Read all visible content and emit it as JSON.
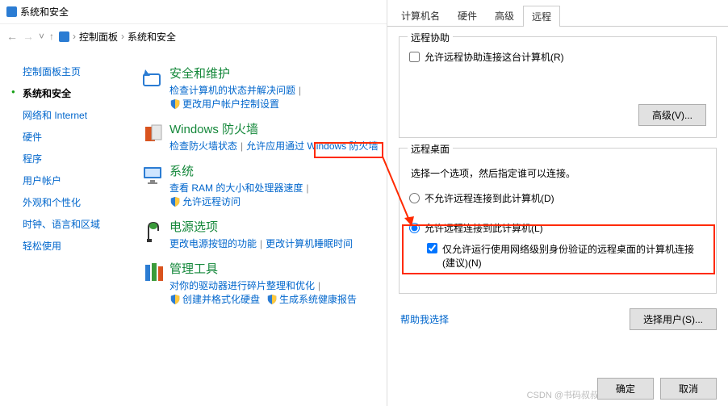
{
  "header": {
    "title": "系统和安全"
  },
  "breadcrumb": {
    "root": "控制面板",
    "current": "系统和安全"
  },
  "sidebar": {
    "items": [
      {
        "label": "控制面板主页"
      },
      {
        "label": "系统和安全",
        "active": true
      },
      {
        "label": "网络和 Internet"
      },
      {
        "label": "硬件"
      },
      {
        "label": "程序"
      },
      {
        "label": "用户帐户"
      },
      {
        "label": "外观和个性化"
      },
      {
        "label": "时钟、语言和区域"
      },
      {
        "label": "轻松使用"
      }
    ]
  },
  "categories": [
    {
      "title": "安全和维护",
      "links": [
        {
          "text": "检查计算机的状态并解决问题",
          "shield": false
        },
        {
          "text": "更改用户帐户控制设置",
          "shield": true
        }
      ]
    },
    {
      "title": "Windows 防火墙",
      "links": [
        {
          "text": "检查防火墙状态",
          "shield": false
        },
        {
          "text": "允许应用通过 Windows 防火墙",
          "shield": false
        }
      ]
    },
    {
      "title": "系统",
      "links": [
        {
          "text": "查看 RAM 的大小和处理器速度",
          "shield": false
        },
        {
          "text": "允许远程访问",
          "shield": true,
          "highlight": true
        }
      ]
    },
    {
      "title": "电源选项",
      "links": [
        {
          "text": "更改电源按钮的功能",
          "shield": false
        },
        {
          "text": "更改计算机睡眠时间",
          "shield": false
        }
      ]
    },
    {
      "title": "管理工具",
      "links": [
        {
          "text": "对你的驱动器进行碎片整理和优化",
          "shield": false
        },
        {
          "text": "创建并格式化硬盘",
          "shield": true
        },
        {
          "text": "生成系统健康报告",
          "shield": true
        }
      ]
    }
  ],
  "dialog": {
    "tabs": [
      "计算机名",
      "硬件",
      "高级",
      "远程"
    ],
    "activeTab": "远程",
    "group1": {
      "title": "远程协助",
      "checkbox": "允许远程协助连接这台计算机(R)",
      "advancedBtn": "高级(V)..."
    },
    "group2": {
      "title": "远程桌面",
      "desc": "选择一个选项，然后指定谁可以连接。",
      "radio1": "不允许远程连接到此计算机(D)",
      "radio2": "允许远程连接到此计算机(L)",
      "subCheck": "仅允许运行使用网络级别身份验证的远程桌面的计算机连接(建议)(N)",
      "helpLink": "帮助我选择",
      "selectUsersBtn": "选择用户(S)..."
    },
    "footer": {
      "ok": "确定",
      "cancel": "取消"
    },
    "watermark": "CSDN @书码叔叔"
  }
}
